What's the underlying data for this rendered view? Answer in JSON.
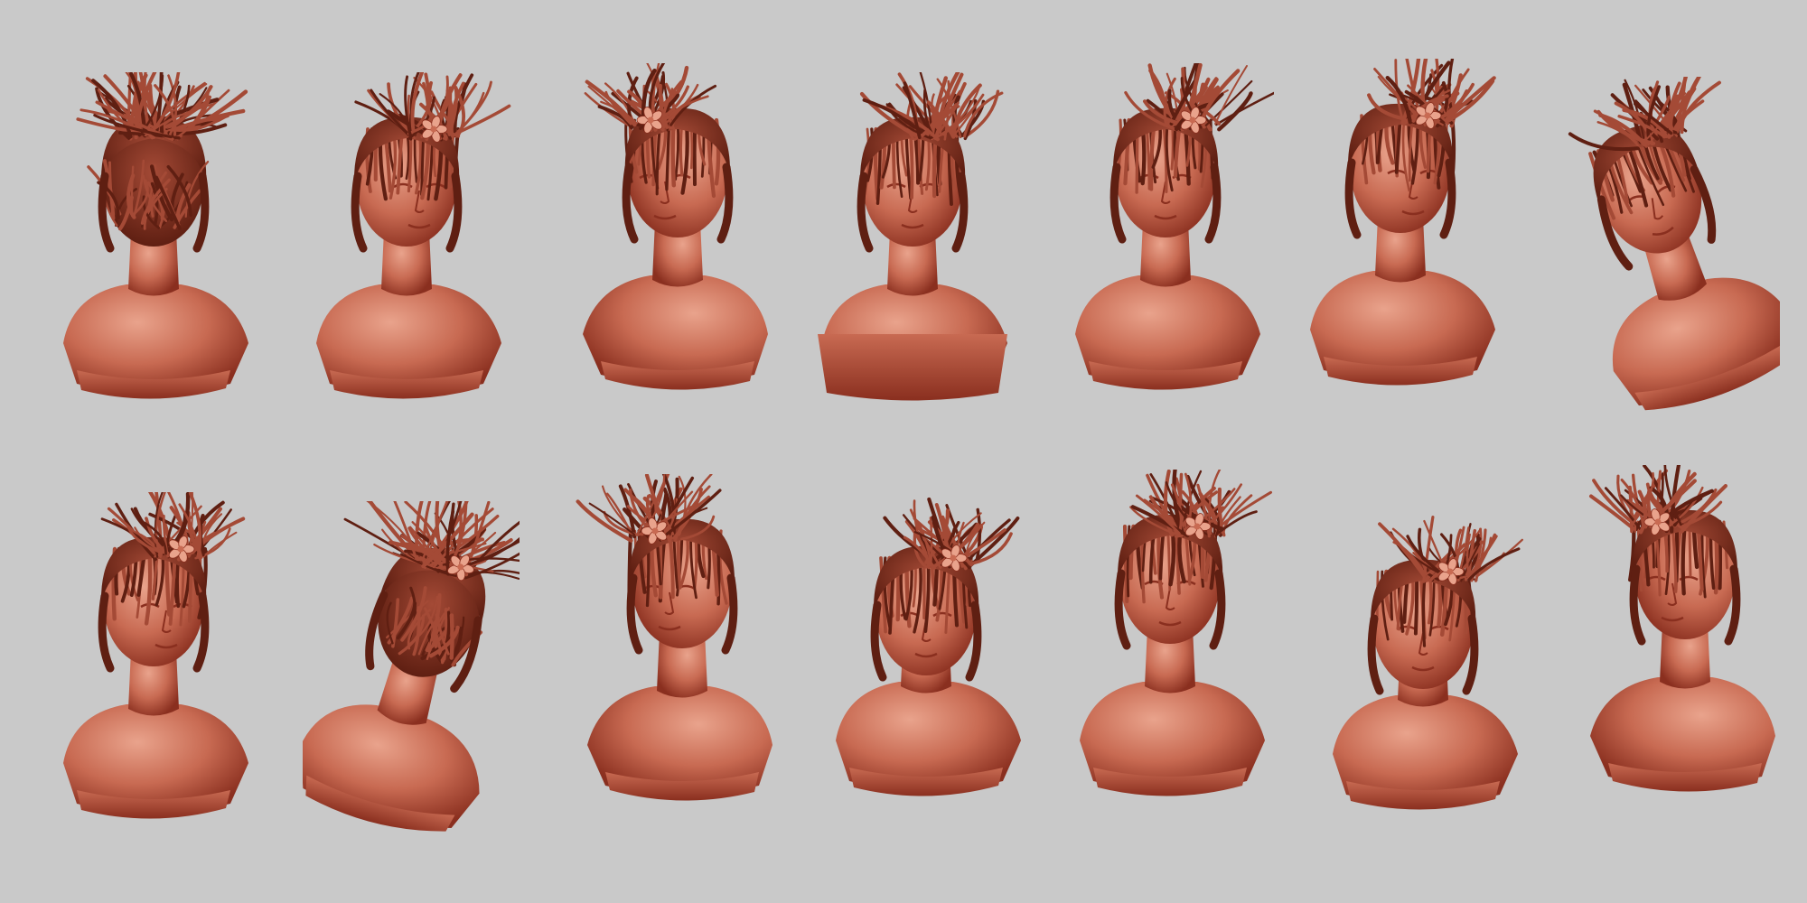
{
  "scene": {
    "background_color": "#c9c9c9",
    "clay_color": "#c86a52",
    "clay_shadow_color": "#8a2f1f",
    "clay_highlight_color": "#e9a38c",
    "hair_color": "#a44a36",
    "hair_dark_color": "#5f1f12"
  },
  "rows": [
    {
      "busts": [
        {
          "view": "back",
          "flip": false,
          "flower": false
        },
        {
          "view": "three-quarter",
          "flip": false,
          "flower": true
        },
        {
          "view": "profile",
          "flip": true,
          "flower": true
        },
        {
          "view": "front-up",
          "flip": false,
          "flower": false
        },
        {
          "view": "front",
          "flip": false,
          "flower": true
        },
        {
          "view": "back-three-quarter",
          "flip": false,
          "flower": true
        },
        {
          "view": "tilted",
          "flip": false,
          "flower": false
        }
      ]
    },
    {
      "busts": [
        {
          "view": "three-quarter",
          "flip": false,
          "flower": true
        },
        {
          "view": "back-tilted",
          "flip": false,
          "flower": true
        },
        {
          "view": "three-quarter",
          "flip": true,
          "flower": true
        },
        {
          "view": "down",
          "flip": false,
          "flower": true
        },
        {
          "view": "front",
          "flip": false,
          "flower": true
        },
        {
          "view": "down",
          "flip": false,
          "flower": true
        },
        {
          "view": "three-quarter",
          "flip": true,
          "flower": true
        }
      ]
    }
  ]
}
